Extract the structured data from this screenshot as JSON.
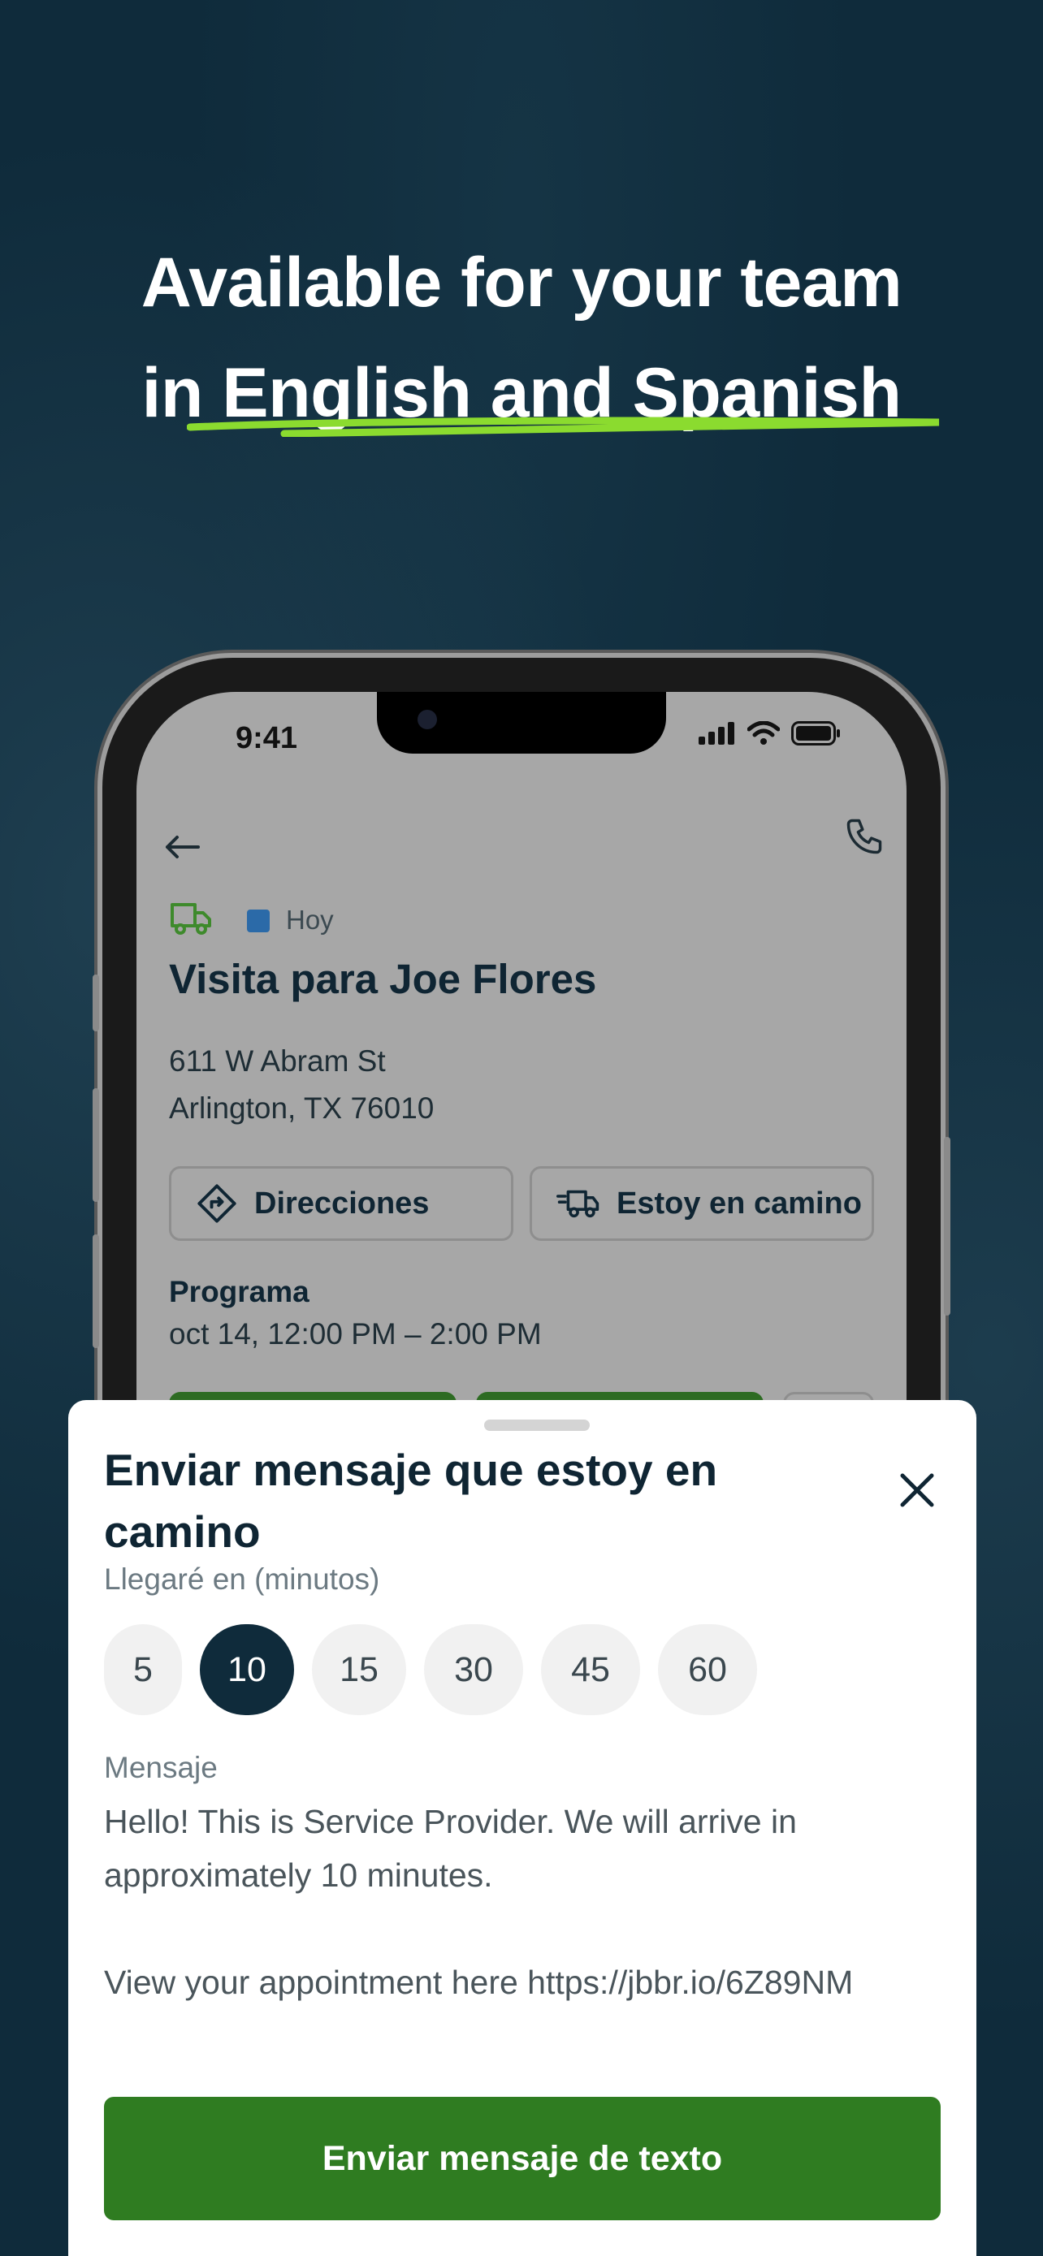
{
  "headline": {
    "line1": "Available for your team",
    "line2_prefix": "in ",
    "line2_highlight": "English and Spanish"
  },
  "colors": {
    "background": "#0f2b3b",
    "accent_underline": "#8bdb2f",
    "primary_green": "#2f7c21",
    "selected_chip": "#0f2b3b"
  },
  "status_bar": {
    "time": "9:41",
    "icons": [
      "signal-icon",
      "wifi-icon",
      "battery-icon"
    ]
  },
  "visit": {
    "day_badge": "Hoy",
    "title": "Visita para Joe Flores",
    "address_line1": "611 W Abram St",
    "address_line2": "Arlington, TX 76010",
    "directions_label": "Direcciones",
    "on_my_way_label": "Estoy en camino",
    "schedule_label": "Programa",
    "schedule_value": "oct 14, 12:00 PM – 2:00 PM"
  },
  "sheet": {
    "title": "Enviar mensaje que estoy en camino",
    "arrive_label": "Llegaré en (minutos)",
    "minutes": [
      "5",
      "10",
      "15",
      "30",
      "45",
      "60"
    ],
    "selected_minutes": "10",
    "message_label": "Mensaje",
    "message_line1": "Hello! This is Service Provider. We will arrive in approximately 10 minutes.",
    "message_line2": "View your appointment here https://jbbr.io/6Z89NM",
    "send_label": "Enviar mensaje de texto"
  }
}
